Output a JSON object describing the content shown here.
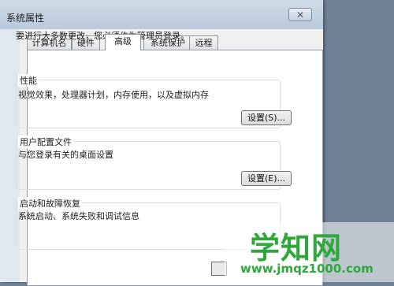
{
  "window": {
    "title": "系统属性",
    "close_glyph": "✕"
  },
  "tabs": [
    {
      "label": "计算机名"
    },
    {
      "label": "硬件"
    },
    {
      "label": "高级",
      "active": true
    },
    {
      "label": "系统保护"
    },
    {
      "label": "远程"
    }
  ],
  "panel": {
    "admin_note": "要进行大多数更改，您必须作为管理员登录。",
    "performance": {
      "label": "性能",
      "desc": "视觉效果，处理器计划，内存使用，以及虚拟内存",
      "button": "设置(S)..."
    },
    "user_profiles": {
      "label": "用户配置文件",
      "desc": "与您登录有关的桌面设置",
      "button": "设置(E)..."
    },
    "startup_recovery": {
      "label": "启动和故障恢复",
      "desc": "系统启动、系统失败和调试信息"
    }
  },
  "watermark": {
    "title": "学知网",
    "url": "www.jmqz1000.com"
  },
  "colors": {
    "watermark": "#2ea83b",
    "desktop": "#6e8196"
  }
}
